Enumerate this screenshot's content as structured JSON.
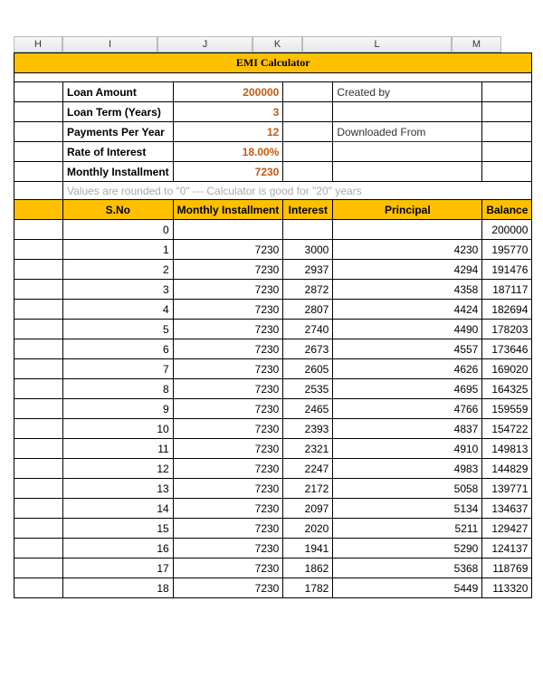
{
  "columns": [
    "H",
    "I",
    "J",
    "K",
    "L",
    "M"
  ],
  "title": "EMI Calculator",
  "params": {
    "loan_amount_label": "Loan Amount",
    "loan_amount_value": "200000",
    "loan_term_label": "Loan Term (Years)",
    "loan_term_value": "3",
    "payments_per_year_label": "Payments Per Year",
    "payments_per_year_value": "12",
    "rate_label": "Rate of Interest",
    "rate_value": "18.00%",
    "monthly_installment_label": "Monthly Installment",
    "monthly_installment_value": "7230"
  },
  "side": {
    "created_by": "Created by",
    "downloaded_from": "Downloaded From"
  },
  "note": "Values are rounded to \"0\"  ---  Calculator is good for \"20\" years",
  "table": {
    "headers": {
      "sno": "S.No",
      "monthly_installment": "Monthly Installment",
      "interest": "Interest",
      "principal": "Principal",
      "balance": "Balance"
    },
    "rows": [
      {
        "sno": "0",
        "mi": "",
        "interest": "",
        "principal": "",
        "balance": "200000"
      },
      {
        "sno": "1",
        "mi": "7230",
        "interest": "3000",
        "principal": "4230",
        "balance": "195770"
      },
      {
        "sno": "2",
        "mi": "7230",
        "interest": "2937",
        "principal": "4294",
        "balance": "191476"
      },
      {
        "sno": "3",
        "mi": "7230",
        "interest": "2872",
        "principal": "4358",
        "balance": "187117"
      },
      {
        "sno": "4",
        "mi": "7230",
        "interest": "2807",
        "principal": "4424",
        "balance": "182694"
      },
      {
        "sno": "5",
        "mi": "7230",
        "interest": "2740",
        "principal": "4490",
        "balance": "178203"
      },
      {
        "sno": "6",
        "mi": "7230",
        "interest": "2673",
        "principal": "4557",
        "balance": "173646"
      },
      {
        "sno": "7",
        "mi": "7230",
        "interest": "2605",
        "principal": "4626",
        "balance": "169020"
      },
      {
        "sno": "8",
        "mi": "7230",
        "interest": "2535",
        "principal": "4695",
        "balance": "164325"
      },
      {
        "sno": "9",
        "mi": "7230",
        "interest": "2465",
        "principal": "4766",
        "balance": "159559"
      },
      {
        "sno": "10",
        "mi": "7230",
        "interest": "2393",
        "principal": "4837",
        "balance": "154722"
      },
      {
        "sno": "11",
        "mi": "7230",
        "interest": "2321",
        "principal": "4910",
        "balance": "149813"
      },
      {
        "sno": "12",
        "mi": "7230",
        "interest": "2247",
        "principal": "4983",
        "balance": "144829"
      },
      {
        "sno": "13",
        "mi": "7230",
        "interest": "2172",
        "principal": "5058",
        "balance": "139771"
      },
      {
        "sno": "14",
        "mi": "7230",
        "interest": "2097",
        "principal": "5134",
        "balance": "134637"
      },
      {
        "sno": "15",
        "mi": "7230",
        "interest": "2020",
        "principal": "5211",
        "balance": "129427"
      },
      {
        "sno": "16",
        "mi": "7230",
        "interest": "1941",
        "principal": "5290",
        "balance": "124137"
      },
      {
        "sno": "17",
        "mi": "7230",
        "interest": "1862",
        "principal": "5368",
        "balance": "118769"
      },
      {
        "sno": "18",
        "mi": "7230",
        "interest": "1782",
        "principal": "5449",
        "balance": "113320"
      }
    ]
  }
}
